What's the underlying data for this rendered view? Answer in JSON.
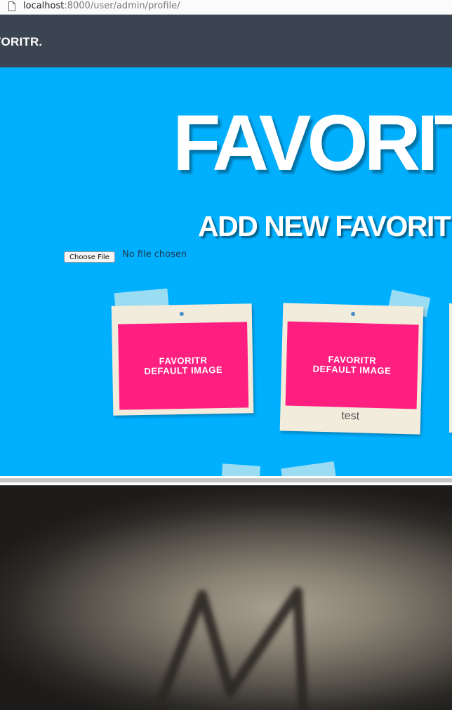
{
  "browser": {
    "url_host": "localhost",
    "url_rest": ":8000/user/admin/profile/"
  },
  "navbar": {
    "brand": "VORITR."
  },
  "hero": {
    "title": "FAVORIT",
    "add_heading": "ADD NEW FAVORIT"
  },
  "upload": {
    "button_label": "Choose File",
    "status": "No file chosen"
  },
  "favorites": [
    {
      "image_text": "FAVORITR\nDEFAULT IMAGE",
      "caption": ""
    },
    {
      "image_text": "FAVORITR\nDEFAULT IMAGE",
      "caption": "test"
    }
  ],
  "colors": {
    "nav_bg": "#3b4451",
    "hero_bg": "#00b0ff",
    "card_bg": "#f2ecdc",
    "default_image_bg": "#ff1f80"
  }
}
